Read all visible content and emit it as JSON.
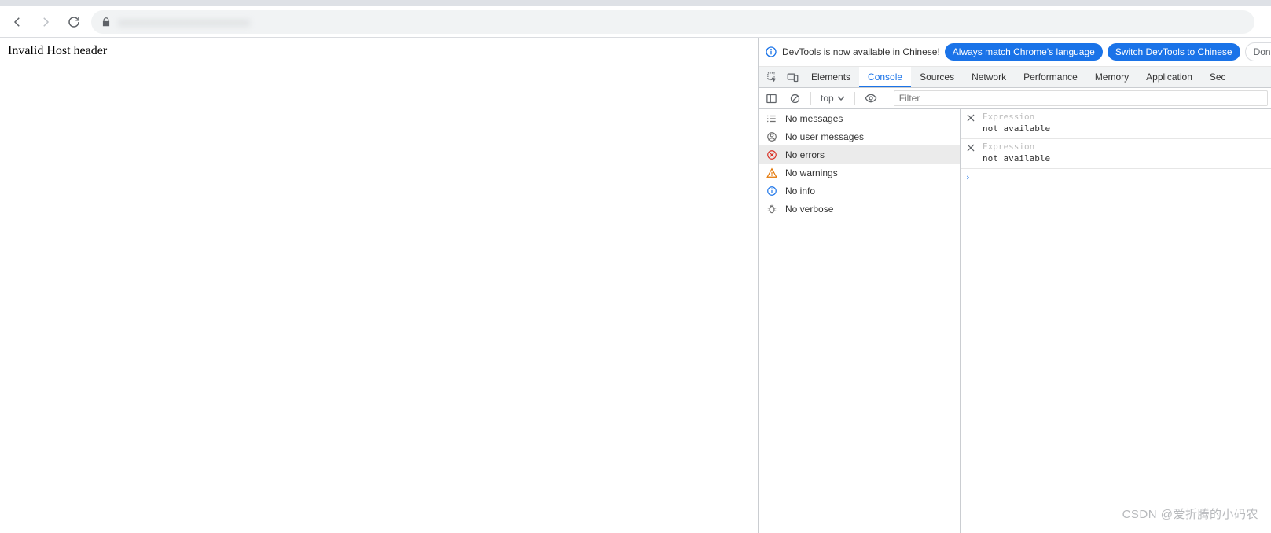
{
  "browser": {
    "url_obscured": "xxxxxxxxxxxxxxxxxxxxxxxx"
  },
  "page": {
    "body_text": "Invalid Host header"
  },
  "devtools": {
    "infobar": {
      "message": "DevTools is now available in Chinese!",
      "button_primary": "Always match Chrome's language",
      "button_secondary": "Switch DevTools to Chinese",
      "button_dismiss": "Don't"
    },
    "tabs": [
      "Elements",
      "Console",
      "Sources",
      "Network",
      "Performance",
      "Memory",
      "Application",
      "Sec"
    ],
    "active_tab": "Console",
    "context": "top",
    "filter_placeholder": "Filter",
    "sidebar": [
      {
        "label": "No messages"
      },
      {
        "label": "No user messages"
      },
      {
        "label": "No errors"
      },
      {
        "label": "No warnings"
      },
      {
        "label": "No info"
      },
      {
        "label": "No verbose"
      }
    ],
    "watch": [
      {
        "expr_placeholder": "Expression",
        "value": "not available"
      },
      {
        "expr_placeholder": "Expression",
        "value": "not available"
      }
    ],
    "prompt": "›"
  },
  "watermark": "CSDN @爱折腾的小码农"
}
